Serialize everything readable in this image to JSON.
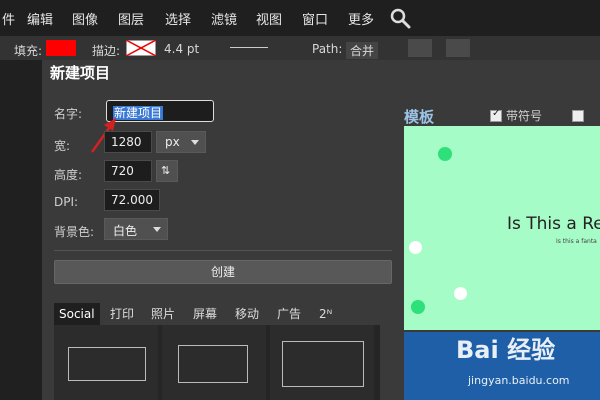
{
  "menubar": {
    "items": [
      "件",
      "编辑",
      "图像",
      "图层",
      "选择",
      "滤镜",
      "视图",
      "窗口",
      "更多"
    ]
  },
  "toolbar": {
    "fill_label": "填充:",
    "stroke_label": "描边:",
    "stroke_width": "4.4 pt",
    "path_label": "Path:",
    "path_mode": "合并"
  },
  "dialog": {
    "title": "新建项目",
    "name_label": "名字:",
    "name_value": "新建项目",
    "width_label": "宽:",
    "width_value": "1280",
    "unit": "px",
    "height_label": "高度:",
    "height_value": "720",
    "dpi_label": "DPI:",
    "dpi_value": "72.000",
    "bg_label": "背景色:",
    "bg_value": "白色",
    "create_label": "创建",
    "tabs": [
      "Social",
      "打印",
      "照片",
      "屏幕",
      "移动",
      "广告",
      "2ᴺ"
    ],
    "active_tab": "Social"
  },
  "templates": {
    "title": "模板",
    "with_symbols_label": "带符号",
    "with_symbols_checked": true,
    "preview_title": "Is This a Re",
    "preview_subtitle": "Is this a fanta"
  },
  "colors": {
    "fill_color": "#ff0000",
    "preview_bg": "#a6fcc6",
    "accent_blue": "#9cc3e6"
  },
  "watermark": {
    "brand": "Bai 经验",
    "url": "jingyan.baidu.com"
  }
}
